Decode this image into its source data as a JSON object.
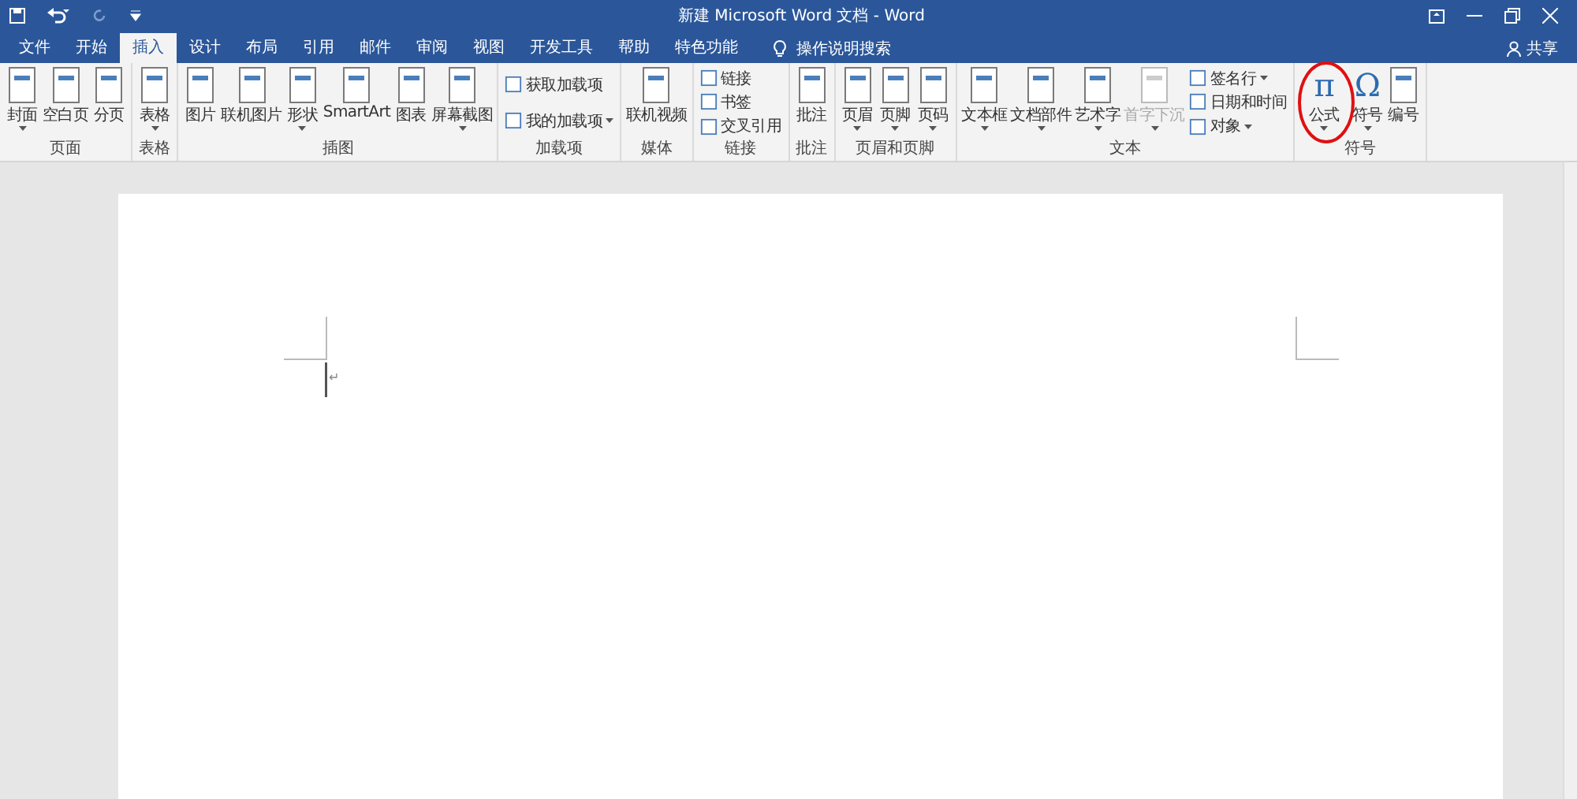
{
  "window": {
    "title": "新建 Microsoft Word 文档 - Word"
  },
  "tabs": [
    {
      "label": "文件",
      "selected": false
    },
    {
      "label": "开始",
      "selected": false
    },
    {
      "label": "插入",
      "selected": true
    },
    {
      "label": "设计",
      "selected": false
    },
    {
      "label": "布局",
      "selected": false
    },
    {
      "label": "引用",
      "selected": false
    },
    {
      "label": "邮件",
      "selected": false
    },
    {
      "label": "审阅",
      "selected": false
    },
    {
      "label": "视图",
      "selected": false
    },
    {
      "label": "开发工具",
      "selected": false
    },
    {
      "label": "帮助",
      "selected": false
    },
    {
      "label": "特色功能",
      "selected": false
    }
  ],
  "tell_me": {
    "placeholder": "操作说明搜索"
  },
  "share": "共享",
  "ribbon": [
    {
      "label": "页面",
      "items": [
        {
          "kind": "large",
          "label": "封面",
          "dropdown": true
        },
        {
          "kind": "large",
          "label": "空白页"
        },
        {
          "kind": "large",
          "label": "分页"
        }
      ]
    },
    {
      "label": "表格",
      "items": [
        {
          "kind": "large",
          "label": "表格",
          "dropdown": true
        }
      ]
    },
    {
      "label": "插图",
      "items": [
        {
          "kind": "large",
          "label": "图片"
        },
        {
          "kind": "large",
          "label": "联机图片"
        },
        {
          "kind": "large",
          "label": "形状",
          "dropdown": true
        },
        {
          "kind": "large",
          "label": "SmartArt"
        },
        {
          "kind": "large",
          "label": "图表"
        },
        {
          "kind": "large",
          "label": "屏幕截图",
          "dropdown": true
        }
      ]
    },
    {
      "label": "加载项",
      "items": [
        {
          "kind": "small",
          "label": "获取加载项"
        },
        {
          "kind": "small",
          "label": "我的加载项",
          "dropdown": true
        }
      ]
    },
    {
      "label": "媒体",
      "items": [
        {
          "kind": "large",
          "label": "联机视频"
        }
      ]
    },
    {
      "label": "链接",
      "items": [
        {
          "kind": "small",
          "label": "链接"
        },
        {
          "kind": "small",
          "label": "书签"
        },
        {
          "kind": "small",
          "label": "交叉引用"
        }
      ]
    },
    {
      "label": "批注",
      "items": [
        {
          "kind": "large",
          "label": "批注"
        }
      ]
    },
    {
      "label": "页眉和页脚",
      "items": [
        {
          "kind": "large",
          "label": "页眉",
          "dropdown": true
        },
        {
          "kind": "large",
          "label": "页脚",
          "dropdown": true
        },
        {
          "kind": "large",
          "label": "页码",
          "dropdown": true
        }
      ]
    },
    {
      "label": "文本",
      "items": [
        {
          "kind": "large",
          "label": "文本框",
          "dropdown": true
        },
        {
          "kind": "large",
          "label": "文档部件",
          "dropdown": true
        },
        {
          "kind": "large",
          "label": "艺术字",
          "dropdown": true
        },
        {
          "kind": "large",
          "label": "首字下沉",
          "dropdown": true,
          "disabled": true
        },
        {
          "kind": "small",
          "label": "签名行",
          "dropdown": true
        },
        {
          "kind": "small",
          "label": "日期和时间"
        },
        {
          "kind": "small",
          "label": "对象",
          "dropdown": true
        }
      ]
    },
    {
      "label": "符号",
      "items": [
        {
          "kind": "glyph",
          "glyph": "π",
          "label": "公式",
          "dropdown": true,
          "circled": true
        },
        {
          "kind": "glyph",
          "glyph": "Ω",
          "label": "符号",
          "dropdown": true
        },
        {
          "kind": "large",
          "label": "编号"
        }
      ]
    }
  ],
  "document": {
    "paragraph_mark": "↵"
  }
}
